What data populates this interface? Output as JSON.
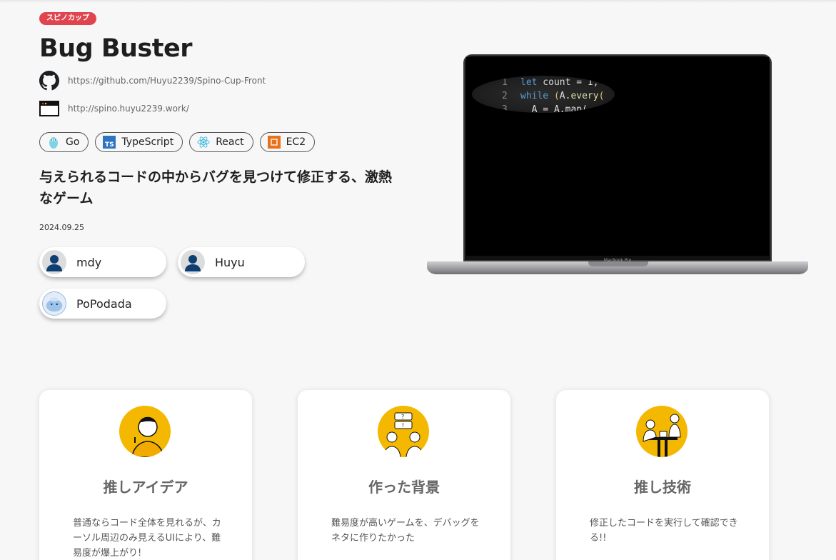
{
  "badge": "スピノカップ",
  "title": "Bug Buster",
  "links": {
    "github": "https://github.com/Huyu2239/Spino-Cup-Front",
    "site": "http://spino.huyu2239.work/"
  },
  "tech": [
    "Go",
    "TypeScript",
    "React",
    "EC2"
  ],
  "description": "与えられるコードの中からバグを見つけて修正する、激熱なゲーム",
  "date": "2024.09.25",
  "members": [
    "mdy",
    "Huyu",
    "PoPodada"
  ],
  "laptop": {
    "code": [
      {
        "num": "1",
        "text": "let count = 1;"
      },
      {
        "num": "2",
        "text": "while (A.every("
      },
      {
        "num": "3",
        "text": "  A = A.map("
      }
    ],
    "label": "MacBook Pro"
  },
  "cards": [
    {
      "title": "推しアイデア",
      "body": "普通ならコード全体を見れるが、カーソル周辺のみ見えるUIにより、難易度が爆上がり!"
    },
    {
      "title": "作った背景",
      "body": "難易度が高いゲームを、デバッグをネタに作りたかった"
    },
    {
      "title": "推し技術",
      "body": "修正したコードを実行して確認できる!!"
    }
  ]
}
